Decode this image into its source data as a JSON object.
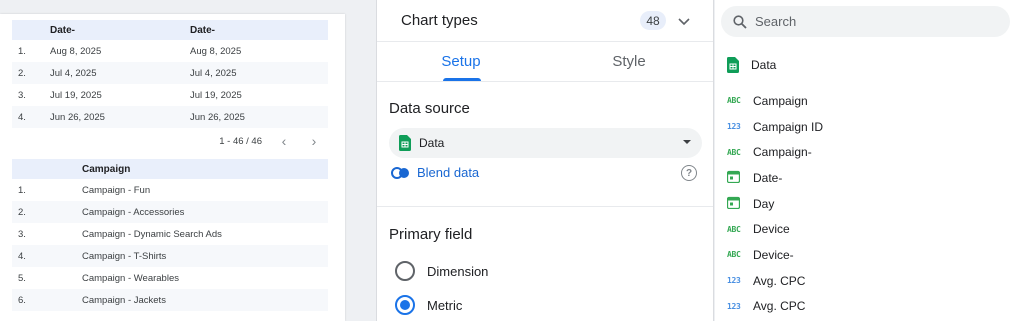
{
  "colors": {
    "accent": "#1a73e8",
    "sheets_green": "#0f9d58",
    "text_type": "#34a853",
    "number_type": "#4a90e2"
  },
  "canvas": {
    "table1": {
      "headers": [
        "",
        "Date-",
        "Date-"
      ],
      "rows": [
        {
          "num": "1.",
          "d1": "Aug 8, 2025",
          "d2": "Aug 8, 2025"
        },
        {
          "num": "2.",
          "d1": "Jul 4, 2025",
          "d2": "Jul 4, 2025"
        },
        {
          "num": "3.",
          "d1": "Jul 19, 2025",
          "d2": "Jul 19, 2025"
        },
        {
          "num": "4.",
          "d1": "Jun 26, 2025",
          "d2": "Jun 26, 2025"
        }
      ],
      "pager_text": "1 - 46 / 46",
      "prev_icon": "chevron-left-icon",
      "next_icon": "chevron-right-icon"
    },
    "table2": {
      "header": "Campaign",
      "rows": [
        {
          "num": "1.",
          "name": "Campaign - Fun"
        },
        {
          "num": "2.",
          "name": "Campaign - Accessories"
        },
        {
          "num": "3.",
          "name": "Campaign - Dynamic Search Ads"
        },
        {
          "num": "4.",
          "name": "Campaign - T-Shirts"
        },
        {
          "num": "5.",
          "name": "Campaign - Wearables"
        },
        {
          "num": "6.",
          "name": "Campaign - Jackets"
        }
      ]
    }
  },
  "setup_panel": {
    "chart_types_label": "Chart types",
    "chart_types_count": "48",
    "tabs": [
      {
        "label": "Setup",
        "active": true
      },
      {
        "label": "Style",
        "active": false
      }
    ],
    "data_source_title": "Data source",
    "data_source_value": "Data",
    "blend_label": "Blend data",
    "help_glyph": "?",
    "primary_field_title": "Primary field",
    "options": [
      {
        "label": "Dimension",
        "checked": false
      },
      {
        "label": "Metric",
        "checked": true
      }
    ]
  },
  "fields_panel": {
    "search_placeholder": "Search",
    "data_header": "Data",
    "fields": [
      {
        "type": "text",
        "type_label": "ABC",
        "name": "Campaign"
      },
      {
        "type": "num",
        "type_label": "123",
        "name": "Campaign ID"
      },
      {
        "type": "text",
        "type_label": "ABC",
        "name": "Campaign-"
      },
      {
        "type": "date",
        "type_label": "",
        "name": "Date-"
      },
      {
        "type": "date",
        "type_label": "",
        "name": "Day"
      },
      {
        "type": "text",
        "type_label": "ABC",
        "name": "Device"
      },
      {
        "type": "text",
        "type_label": "ABC",
        "name": "Device-"
      },
      {
        "type": "num",
        "type_label": "123",
        "name": "Avg. CPC"
      },
      {
        "type": "num",
        "type_label": "123",
        "name": "Avg. CPC"
      }
    ]
  }
}
